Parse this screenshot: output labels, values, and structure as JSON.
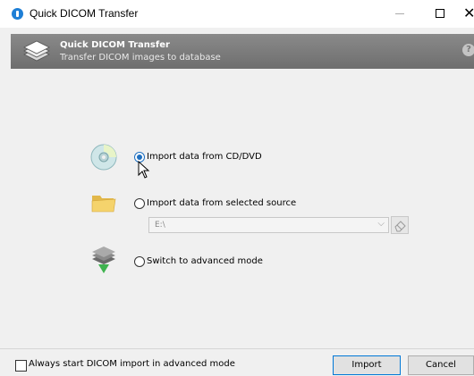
{
  "window": {
    "title": "Quick DICOM Transfer",
    "controls": {
      "minimize": "—",
      "maximize": "□",
      "close": "✕"
    }
  },
  "banner": {
    "title": "Quick DICOM Transfer",
    "subtitle": "Transfer DICOM images to database",
    "help_glyph": "?"
  },
  "options": [
    {
      "label": "Import data from CD/DVD",
      "selected": true,
      "icon": "cd-dvd-icon"
    },
    {
      "label": "Import data from selected source",
      "selected": false,
      "icon": "folder-icon"
    },
    {
      "label": "Switch to advanced mode",
      "selected": false,
      "icon": "advanced-mode-icon"
    }
  ],
  "source": {
    "value": "E:\\",
    "chevron": "⌵"
  },
  "footer": {
    "always_advanced_label": "Always start DICOM import in advanced mode",
    "always_advanced_checked": false,
    "import_label": "Import",
    "cancel_label": "Cancel"
  },
  "colors": {
    "accent": "#1e6fc0",
    "banner": "#7a7a7a",
    "background": "#f0f0f0"
  }
}
